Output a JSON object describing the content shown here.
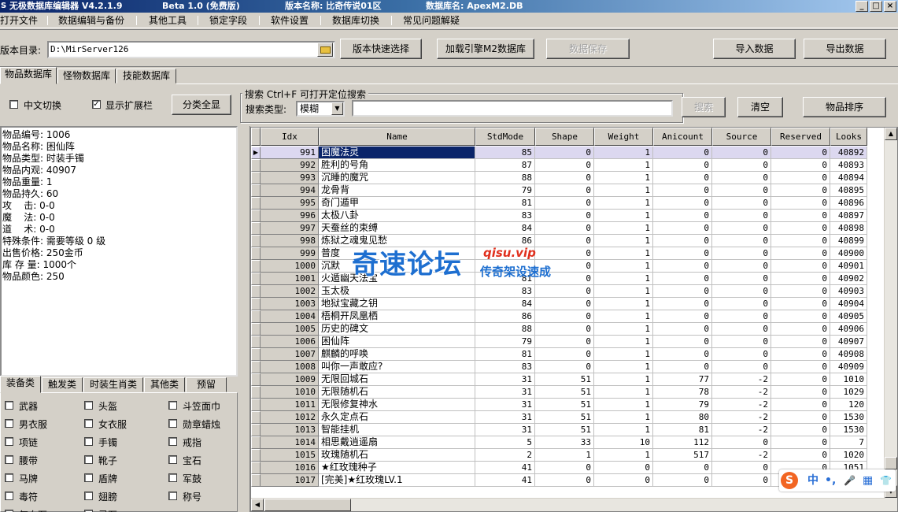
{
  "window": {
    "title_app": "无极数据库编辑器 V4.2.1.9",
    "title_beta": "Beta 1.0 (免费版)",
    "title_version": "版本名称: 比奇传说01区",
    "title_db": "数据库名: ApexM2.DB",
    "min": "_",
    "max": "□",
    "close": "×"
  },
  "menu": [
    "打开文件",
    "数据编辑与备份",
    "其他工具",
    "锁定字段",
    "软件设置",
    "数据库切换",
    "常见问题解疑"
  ],
  "toolbar": {
    "dir_label": "版本目录:",
    "dir_value": "D:\\MirServer126",
    "quick_select": "版本快速选择",
    "load_engine": "加载引擎M2数据库",
    "save_data": "数据保存",
    "import_data": "导入数据",
    "export_data": "导出数据"
  },
  "tabs": [
    "物品数据库",
    "怪物数据库",
    "技能数据库"
  ],
  "options": {
    "cn_switch": "中文切换",
    "show_ext": "显示扩展栏",
    "show_ext_checked": "✓",
    "classify_all": "分类全显"
  },
  "search": {
    "title": "搜索  Ctrl+F 可打开定位搜索",
    "type_label": "搜索类型:",
    "type_value": "模糊",
    "search_btn": "搜索",
    "clear_btn": "清空",
    "sort_btn": "物品排序"
  },
  "info": [
    "物品编号: 1006",
    "物品名称: 困仙阵",
    "物品类型: 时装手镯",
    "物品内观: 40907",
    "物品重量: 1",
    "物品持久: 60",
    "攻    击: 0-0",
    "魔    法: 0-0",
    "道    术: 0-0",
    "特殊条件: 需要等级 0 级",
    "出售价格: 250金币",
    "库 存 量: 1000个",
    "物品颜色: 250"
  ],
  "cat_tabs": [
    "装备类",
    "触发类",
    "时装生肖类",
    "其他类",
    "预留"
  ],
  "cat_items": [
    [
      "武器",
      "头盔",
      "斗笠面巾"
    ],
    [
      "男衣服",
      "女衣服",
      "勋章蜡烛"
    ],
    [
      "项链",
      "手镯",
      "戒指"
    ],
    [
      "腰带",
      "靴子",
      "宝石"
    ],
    [
      "马牌",
      "盾牌",
      "军鼓"
    ],
    [
      "毒符",
      "翅膀",
      "称号"
    ],
    [
      "气血石",
      "灵石",
      ""
    ]
  ],
  "grid": {
    "columns": [
      "Idx",
      "Name",
      "StdMode",
      "Shape",
      "Weight",
      "Anicount",
      "Source",
      "Reserved",
      "Looks"
    ],
    "selected_index": 0,
    "rows": [
      [
        "991",
        "困魔法灵",
        "85",
        "0",
        "1",
        "0",
        "0",
        "0",
        "40892"
      ],
      [
        "992",
        "胜利的号角",
        "87",
        "0",
        "1",
        "0",
        "0",
        "0",
        "40893"
      ],
      [
        "993",
        "沉睡的魔咒",
        "88",
        "0",
        "1",
        "0",
        "0",
        "0",
        "40894"
      ],
      [
        "994",
        "龙骨背",
        "79",
        "0",
        "1",
        "0",
        "0",
        "0",
        "40895"
      ],
      [
        "995",
        "奇门遁甲",
        "81",
        "0",
        "1",
        "0",
        "0",
        "0",
        "40896"
      ],
      [
        "996",
        "太极八卦",
        "83",
        "0",
        "1",
        "0",
        "0",
        "0",
        "40897"
      ],
      [
        "997",
        "天蚕丝的束缚",
        "84",
        "0",
        "1",
        "0",
        "0",
        "0",
        "40898"
      ],
      [
        "998",
        "炼狱之魂鬼见愁",
        "86",
        "0",
        "1",
        "0",
        "0",
        "0",
        "40899"
      ],
      [
        "999",
        "普度",
        "",
        "0",
        "1",
        "0",
        "0",
        "0",
        "40900"
      ],
      [
        "1000",
        "沉默",
        "",
        "0",
        "1",
        "0",
        "0",
        "0",
        "40901"
      ],
      [
        "1001",
        "火遁幽天法宝",
        "81",
        "0",
        "1",
        "0",
        "0",
        "0",
        "40902"
      ],
      [
        "1002",
        "玉太极",
        "83",
        "0",
        "1",
        "0",
        "0",
        "0",
        "40903"
      ],
      [
        "1003",
        "地狱宝藏之钥",
        "84",
        "0",
        "1",
        "0",
        "0",
        "0",
        "40904"
      ],
      [
        "1004",
        "梧桐开凤凰栖",
        "86",
        "0",
        "1",
        "0",
        "0",
        "0",
        "40905"
      ],
      [
        "1005",
        "历史的碑文",
        "88",
        "0",
        "1",
        "0",
        "0",
        "0",
        "40906"
      ],
      [
        "1006",
        "困仙阵",
        "79",
        "0",
        "1",
        "0",
        "0",
        "0",
        "40907"
      ],
      [
        "1007",
        "麒麟的呼唤",
        "81",
        "0",
        "1",
        "0",
        "0",
        "0",
        "40908"
      ],
      [
        "1008",
        "叫你一声敢应?",
        "83",
        "0",
        "1",
        "0",
        "0",
        "0",
        "40909"
      ],
      [
        "1009",
        "无限回城石",
        "31",
        "51",
        "1",
        "77",
        "-2",
        "0",
        "1010"
      ],
      [
        "1010",
        "无限随机石",
        "31",
        "51",
        "1",
        "78",
        "-2",
        "0",
        "1029"
      ],
      [
        "1011",
        "无限修复神水",
        "31",
        "51",
        "1",
        "79",
        "-2",
        "0",
        "120"
      ],
      [
        "1012",
        "永久定点石",
        "31",
        "51",
        "1",
        "80",
        "-2",
        "0",
        "1530"
      ],
      [
        "1013",
        "智能挂机",
        "31",
        "51",
        "1",
        "81",
        "-2",
        "0",
        "1530"
      ],
      [
        "1014",
        "相思戴逍遥扇",
        "5",
        "33",
        "10",
        "112",
        "0",
        "0",
        "7"
      ],
      [
        "1015",
        "玫瑰随机石",
        "2",
        "1",
        "1",
        "517",
        "-2",
        "0",
        "1020"
      ],
      [
        "1016",
        "★红玫瑰种子",
        "41",
        "0",
        "0",
        "0",
        "0",
        "0",
        "1051"
      ],
      [
        "1017",
        "[完美]★红玫瑰LV.1",
        "41",
        "0",
        "0",
        "0",
        "0",
        "0",
        "1051"
      ]
    ]
  },
  "watermark": {
    "main": "奇速论坛",
    "url": "qisu.vip",
    "sub": "传奇架设速成"
  },
  "ime": {
    "logo": "S",
    "lang": "中",
    "punct": "•,",
    "mic": "🎤",
    "keyboard": "▦",
    "skin": "👕"
  },
  "colors": {
    "title_gradient_start": "#0a246a",
    "selection": "#0a246a",
    "selected_row": "#dcd8f0",
    "face": "#d4d0c8",
    "watermark_blue": "#1e6fd0",
    "watermark_red": "#e0301e"
  }
}
